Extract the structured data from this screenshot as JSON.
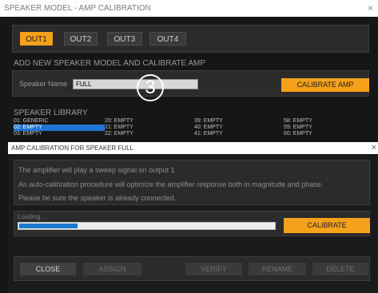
{
  "main_window": {
    "title": "SPEAKER MODEL - AMP CALIBRATION",
    "close_glyph": "×",
    "outputs": [
      {
        "label": "OUT1",
        "active": true
      },
      {
        "label": "OUT2",
        "active": false
      },
      {
        "label": "OUT3",
        "active": false
      },
      {
        "label": "OUT4",
        "active": false
      }
    ],
    "add_section_title": "ADD NEW SPEAKER MODEL AND CALIBRATE AMP",
    "speaker_name_label": "Speaker Name",
    "speaker_name_value": "FULL",
    "calibrate_amp_label": "CALIBRATE AMP",
    "step_marker": "3",
    "library_title": "SPEAKER LIBRARY",
    "library": {
      "col1": [
        "01: GENERIC",
        "02: EMPTY",
        "03: EMPTY"
      ],
      "col2": [
        "20: EMPTY",
        "21: EMPTY",
        "22: EMPTY"
      ],
      "col3": [
        "39: EMPTY",
        "40: EMPTY",
        "41: EMPTY"
      ],
      "col4": [
        "58: EMPTY",
        "59: EMPTY",
        "60: EMPTY"
      ],
      "selected": "02: EMPTY"
    }
  },
  "dialog": {
    "title": "AMP CALIBRATION FOR SPEAKER FULL",
    "close_glyph": "×",
    "messages": [
      "The amplifier will play a sweep signal on output 1",
      "An auto-calibration procedure will optimize the amplifier response both in magnitude and phase.",
      "Please be sure the speaker is already connected."
    ],
    "loading_label": "Loading...",
    "progress": 0.23,
    "calibrate_label": "CALIBRATE",
    "buttons": {
      "close": "CLOSE",
      "assign": "ASSIGN",
      "verify": "VERIFY",
      "rename": "RENAME",
      "delete": "DELETE"
    }
  },
  "colors": {
    "accent": "#f5a11b",
    "selection": "#1f73d6",
    "progress": "#1f79d0"
  }
}
